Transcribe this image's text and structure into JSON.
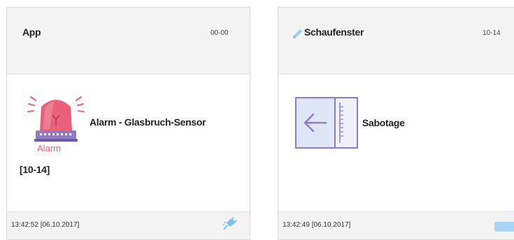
{
  "cards": [
    {
      "title": "App",
      "code": "00-00",
      "icon": "alarm-siren-icon",
      "icon_caption": "Alarm",
      "event": "Alarm - Glasbruch-Sensor",
      "zone": "[10-14]",
      "timestamp": "13:42:52 [06.10.2017]",
      "footer_icon": "plug-icon"
    },
    {
      "title": "Schaufenster",
      "code": "10-14",
      "title_icon": "pencil-icon",
      "icon": "sabotage-window-icon",
      "event": "Sabotage",
      "timestamp": "13:42:49 [06.10.2017]",
      "footer_icon": "status-indicator-icon"
    }
  ],
  "colors": {
    "alarm_red": "#e8607a",
    "sabotage_purple": "#8f7bc4",
    "sabotage_fill": "#dfe6f6",
    "accent_blue": "#7ec3ea"
  }
}
